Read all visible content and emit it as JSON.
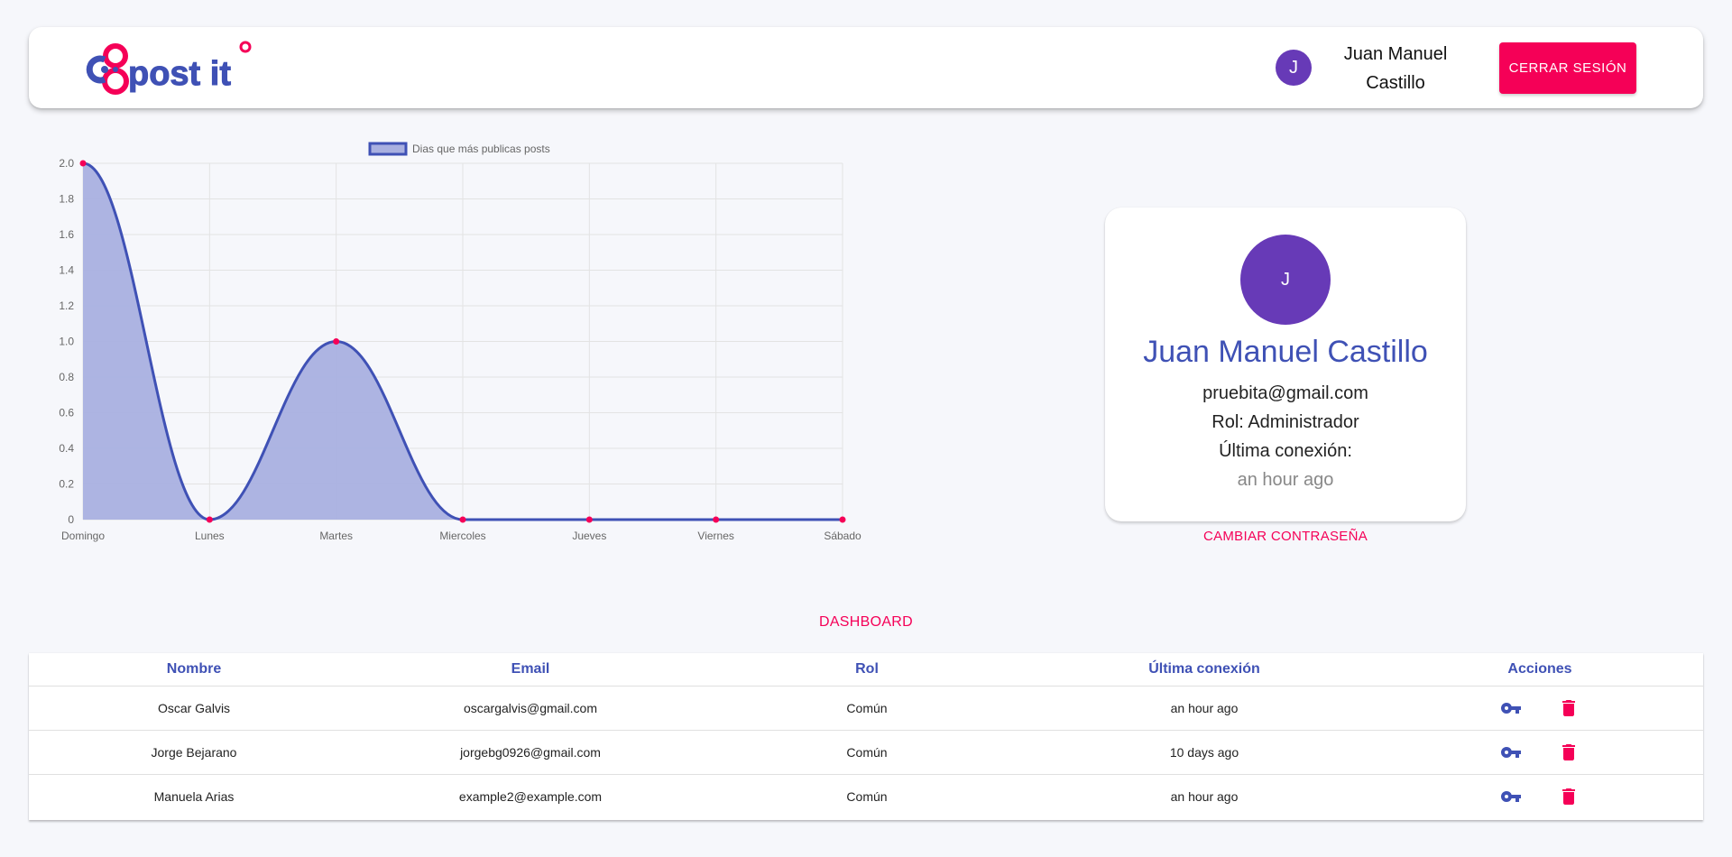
{
  "app": {
    "logo_text": "post it"
  },
  "header": {
    "avatar_initial": "J",
    "user_name": "Juan Manuel Castillo",
    "logout_label": "CERRAR SESIÓN"
  },
  "colors": {
    "primary": "#3f51b5",
    "secondary": "#f50057",
    "avatar": "#673ab7",
    "chart_fill": "#a9b0e0"
  },
  "chart_data": {
    "type": "area",
    "series": [
      {
        "name": "Dias que más publicas posts",
        "values": [
          2,
          0,
          1,
          0,
          0,
          0,
          0
        ]
      }
    ],
    "categories": [
      "Domingo",
      "Lunes",
      "Martes",
      "Miercoles",
      "Jueves",
      "Viernes",
      "Sábado"
    ],
    "yticks": [
      "0",
      "0.2",
      "0.4",
      "0.6",
      "0.8",
      "1.0",
      "1.2",
      "1.4",
      "1.6",
      "1.8",
      "2.0"
    ],
    "ylim": [
      0,
      2
    ],
    "grid": true,
    "legend": "top-center",
    "line_color": "#3f51b5",
    "fill_color": "#a9b0e0",
    "point_color": "#f50057"
  },
  "profile": {
    "avatar_initial": "J",
    "name": "Juan Manuel Castillo",
    "email": "pruebita@gmail.com",
    "role": "Rol: Administrador",
    "last_connection_label": "Última conexión:",
    "last_connection_value": "an hour ago",
    "change_password_label": "CAMBIAR CONTRASEÑA"
  },
  "dashboard": {
    "title": "DASHBOARD",
    "columns": [
      "Nombre",
      "Email",
      "Rol",
      "Última conexión",
      "Acciones"
    ],
    "rows": [
      {
        "nombre": "Oscar Galvis",
        "email": "oscargalvis@gmail.com",
        "rol": "Común",
        "ultima": "an hour ago"
      },
      {
        "nombre": "Jorge Bejarano",
        "email": "jorgebg0926@gmail.com",
        "rol": "Común",
        "ultima": "10 days ago"
      },
      {
        "nombre": "Manuela Arias",
        "email": "example2@example.com",
        "rol": "Común",
        "ultima": "an hour ago"
      }
    ],
    "actions": [
      {
        "icon": "key-icon",
        "color": "#3f51b5"
      },
      {
        "icon": "trash-icon",
        "color": "#f50057"
      }
    ]
  }
}
